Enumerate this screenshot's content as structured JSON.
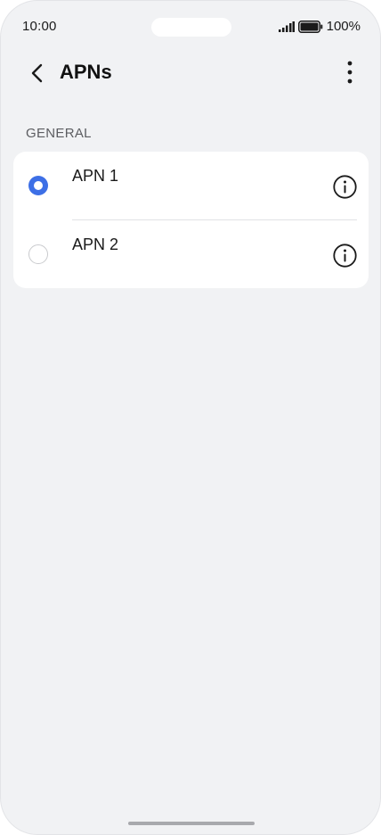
{
  "status_bar": {
    "time": "10:00",
    "battery_text": "100%"
  },
  "header": {
    "title": "APNs"
  },
  "section": {
    "label": "GENERAL"
  },
  "apns": [
    {
      "name": "APN 1",
      "selected": true
    },
    {
      "name": "APN 2",
      "selected": false
    }
  ],
  "colors": {
    "accent": "#3d6fe6",
    "background": "#f1f2f4",
    "card": "#ffffff"
  },
  "icons": {
    "back": "chevron-left-icon",
    "more": "more-vertical-icon",
    "info": "info-icon",
    "signal": "signal-icon",
    "battery": "battery-icon"
  }
}
